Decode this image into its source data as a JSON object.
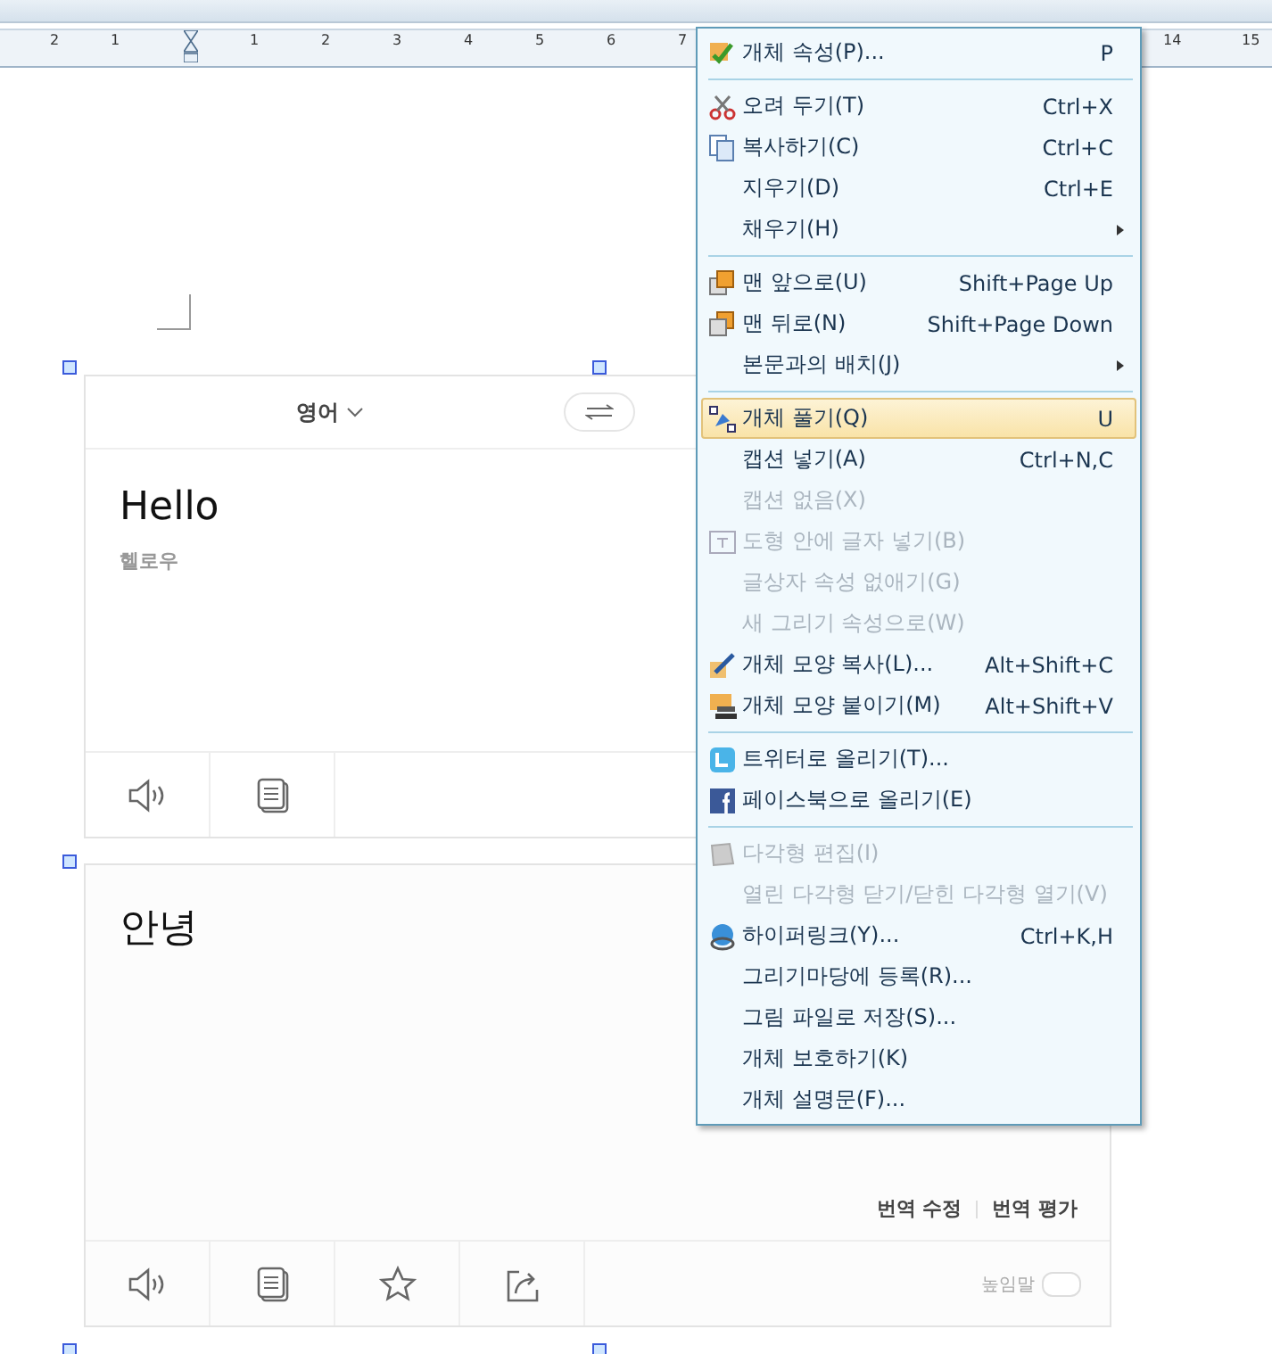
{
  "ruler": {
    "labels": [
      "2",
      "1",
      "1",
      "2",
      "3",
      "4",
      "5",
      "6",
      "7",
      "14",
      "15"
    ]
  },
  "source_card": {
    "language": "영어",
    "text": "Hello",
    "pronunciation": "헬로우",
    "actions": [
      {
        "kind": "speaker"
      },
      {
        "kind": "copy"
      }
    ]
  },
  "target_card": {
    "text": "안녕",
    "links": [
      "번역 수정",
      "번역 평가"
    ],
    "actions": [
      {
        "kind": "speaker"
      },
      {
        "kind": "copy"
      },
      {
        "kind": "star"
      },
      {
        "kind": "share"
      }
    ],
    "honorific": {
      "label": "높임말",
      "on": false
    }
  },
  "context_menu": {
    "items": [
      {
        "kind": "item",
        "label": "개체 속성(P)...",
        "shortcut": "P",
        "disabled": false,
        "selected": false,
        "submenu": false
      },
      {
        "kind": "separator"
      },
      {
        "kind": "item",
        "label": "오려 두기(T)",
        "shortcut": "Ctrl+X",
        "disabled": false,
        "selected": false,
        "submenu": false
      },
      {
        "kind": "item",
        "label": "복사하기(C)",
        "shortcut": "Ctrl+C",
        "disabled": false,
        "selected": false,
        "submenu": false
      },
      {
        "kind": "item",
        "label": "지우기(D)",
        "shortcut": "Ctrl+E",
        "disabled": false,
        "selected": false,
        "submenu": false
      },
      {
        "kind": "item",
        "label": "채우기(H)",
        "disabled": false,
        "selected": false,
        "submenu": true
      },
      {
        "kind": "separator"
      },
      {
        "kind": "item",
        "label": "맨 앞으로(U)",
        "shortcut": "Shift+Page Up",
        "disabled": false,
        "selected": false,
        "submenu": false
      },
      {
        "kind": "item",
        "label": "맨 뒤로(N)",
        "shortcut": "Shift+Page Down",
        "disabled": false,
        "selected": false,
        "submenu": false
      },
      {
        "kind": "item",
        "label": "본문과의 배치(J)",
        "disabled": false,
        "selected": false,
        "submenu": true
      },
      {
        "kind": "separator"
      },
      {
        "kind": "item",
        "label": "개체 풀기(Q)",
        "shortcut": "U",
        "disabled": false,
        "selected": true,
        "submenu": false
      },
      {
        "kind": "item",
        "label": "캡션 넣기(A)",
        "shortcut": "Ctrl+N,C",
        "disabled": false,
        "selected": false,
        "submenu": false
      },
      {
        "kind": "item",
        "label": "캡션 없음(X)",
        "disabled": true,
        "selected": false,
        "submenu": false
      },
      {
        "kind": "item",
        "label": "도형 안에 글자 넣기(B)",
        "disabled": true,
        "selected": false,
        "submenu": false
      },
      {
        "kind": "item",
        "label": "글상자 속성 없애기(G)",
        "disabled": true,
        "selected": false,
        "submenu": false
      },
      {
        "kind": "item",
        "label": "새 그리기 속성으로(W)",
        "disabled": true,
        "selected": false,
        "submenu": false
      },
      {
        "kind": "item",
        "label": "개체 모양 복사(L)...",
        "shortcut": "Alt+Shift+C",
        "disabled": false,
        "selected": false,
        "submenu": false
      },
      {
        "kind": "item",
        "label": "개체 모양 붙이기(M)",
        "shortcut": "Alt+Shift+V",
        "disabled": false,
        "selected": false,
        "submenu": false
      },
      {
        "kind": "separator"
      },
      {
        "kind": "item",
        "label": "트위터로 올리기(T)...",
        "disabled": false,
        "selected": false,
        "submenu": false
      },
      {
        "kind": "item",
        "label": "페이스북으로 올리기(E)",
        "disabled": false,
        "selected": false,
        "submenu": false
      },
      {
        "kind": "separator"
      },
      {
        "kind": "item",
        "label": "다각형 편집(I)",
        "disabled": true,
        "selected": false,
        "submenu": false
      },
      {
        "kind": "item",
        "label": "열린 다각형 닫기/닫힌 다각형 열기(V)",
        "disabled": true,
        "selected": false,
        "submenu": false
      },
      {
        "kind": "item",
        "label": "하이퍼링크(Y)...",
        "shortcut": "Ctrl+K,H",
        "disabled": false,
        "selected": false,
        "submenu": false
      },
      {
        "kind": "item",
        "label": "그리기마당에 등록(R)...",
        "disabled": false,
        "selected": false,
        "submenu": false
      },
      {
        "kind": "item",
        "label": "그림 파일로 저장(S)...",
        "disabled": false,
        "selected": false,
        "submenu": false
      },
      {
        "kind": "item",
        "label": "개체 보호하기(K)",
        "disabled": false,
        "selected": false,
        "submenu": false
      },
      {
        "kind": "item",
        "label": "개체 설명문(F)...",
        "disabled": false,
        "selected": false,
        "submenu": false
      }
    ]
  }
}
